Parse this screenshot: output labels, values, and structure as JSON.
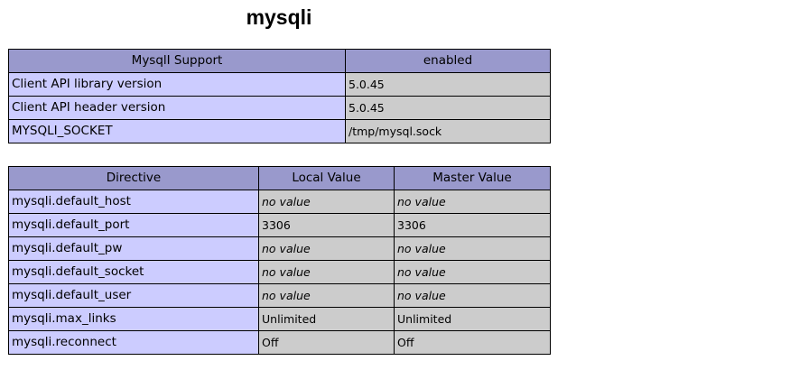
{
  "title": "mysqli",
  "support_table": {
    "header": [
      "MysqlI Support",
      "enabled"
    ],
    "rows": [
      {
        "name": "Client API library version",
        "value": "5.0.45"
      },
      {
        "name": "Client API header version",
        "value": "5.0.45"
      },
      {
        "name": "MYSQLI_SOCKET",
        "value": "/tmp/mysql.sock"
      }
    ]
  },
  "directive_table": {
    "headers": [
      "Directive",
      "Local Value",
      "Master Value"
    ],
    "rows": [
      {
        "directive": "mysqli.default_host",
        "local": "no value",
        "master": "no value"
      },
      {
        "directive": "mysqli.default_port",
        "local": "3306",
        "master": "3306"
      },
      {
        "directive": "mysqli.default_pw",
        "local": "no value",
        "master": "no value"
      },
      {
        "directive": "mysqli.default_socket",
        "local": "no value",
        "master": "no value"
      },
      {
        "directive": "mysqli.default_user",
        "local": "no value",
        "master": "no value"
      },
      {
        "directive": "mysqli.max_links",
        "local": "Unlimited",
        "master": "Unlimited"
      },
      {
        "directive": "mysqli.reconnect",
        "local": "Off",
        "master": "Off"
      }
    ]
  },
  "colors": {
    "header_bg": "#9999cc",
    "name_cell_bg": "#ccccff",
    "value_cell_bg": "#cccccc"
  }
}
